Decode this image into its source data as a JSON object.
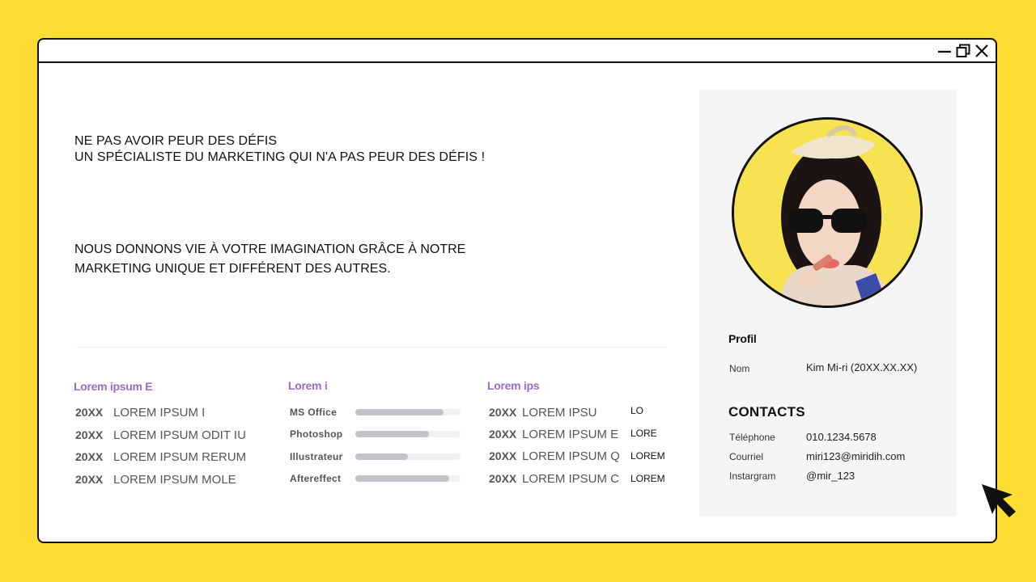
{
  "window": {
    "controls": {
      "minimize": "minimize",
      "maximize": "maximize",
      "close": "close"
    }
  },
  "intro": {
    "headline_line1": "NE PAS AVOIR PEUR DES DÉFIS",
    "headline_line2": "UN SPÉCIALISTE DU MARKETING QUI N'A PAS PEUR DES DÉFIS !",
    "tagline_line1": "NOUS DONNONS VIE À VOTRE IMAGINATION GRÂCE À NOTRE",
    "tagline_line2": "MARKETING UNIQUE ET DIFFÉRENT DES AUTRES."
  },
  "col1": {
    "title": "Lorem ipsum E",
    "rows": [
      {
        "year": "20XX",
        "text": "LOREM IPSUM I"
      },
      {
        "year": "20XX",
        "text": "LOREM IPSUM ODIT IU"
      },
      {
        "year": "20XX",
        "text": "LOREM IPSUM RERUM"
      },
      {
        "year": "20XX",
        "text": "LOREM IPSUM MOLE"
      }
    ]
  },
  "col2": {
    "title": "Lorem i",
    "skills": [
      {
        "name": "MS Office",
        "level": 0.84
      },
      {
        "name": "Photoshop",
        "level": 0.7
      },
      {
        "name": "Illustrateur",
        "level": 0.5
      },
      {
        "name": "Aftereffect",
        "level": 0.89
      }
    ]
  },
  "col3": {
    "title": "Lorem ips",
    "rows": [
      {
        "year": "20XX",
        "text": "LOREM IPSU",
        "tag": "LO"
      },
      {
        "year": "20XX",
        "text": "LOREM IPSUM E",
        "tag": "LORE"
      },
      {
        "year": "20XX",
        "text": "LOREM IPSUM Q",
        "tag": "LOREM"
      },
      {
        "year": "20XX",
        "text": "LOREM IPSUM C",
        "tag": "LOREM"
      }
    ]
  },
  "profile": {
    "title": "Profil",
    "name_label": "Nom",
    "name_value": "Kim Mi-ri (20XX.XX.XX)",
    "contacts_title": "CONTACTS",
    "phone_label": "Téléphone",
    "phone_value": "010.1234.5678",
    "email_label": "Courriel",
    "email_value": "miri123@miridih.com",
    "instagram_label": "Instargram",
    "instagram_value": "@mir_123"
  },
  "colors": {
    "background": "#FFDD33",
    "accent": "#9A6BC0",
    "panel": "#f5f5f7",
    "skill_fill": "#c5c3c9"
  },
  "icons": [
    "minimize-icon",
    "maximize-icon",
    "close-icon",
    "mouse-pointer-icon"
  ]
}
